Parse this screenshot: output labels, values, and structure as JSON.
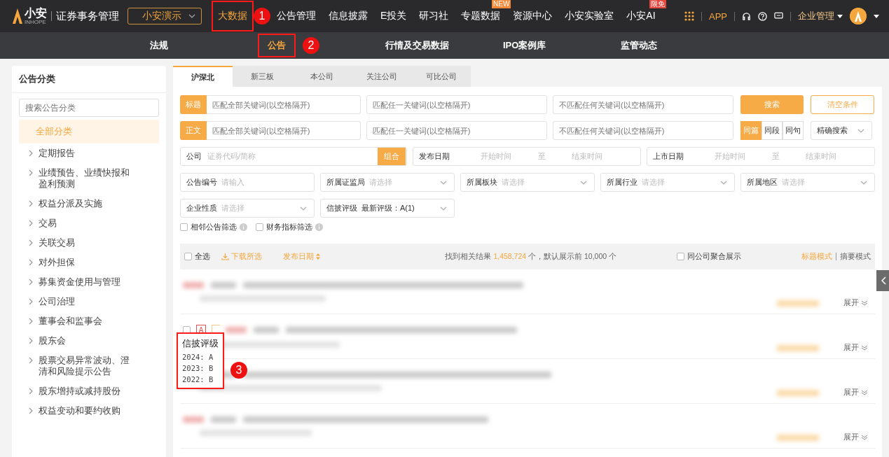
{
  "header": {
    "logo_text": "小安",
    "logo_sub": "INHOPE",
    "app_title": "证券事务管理",
    "org_select": "小安演示",
    "app_link": "APP",
    "company_menu": "企业管理",
    "nav": [
      {
        "label": "大数据",
        "selected": true,
        "callout": "1"
      },
      {
        "label": "公告管理",
        "selected": false
      },
      {
        "label": "信息披露",
        "selected": false
      },
      {
        "label": "E投关",
        "selected": false
      },
      {
        "label": "研习社",
        "selected": false
      },
      {
        "label": "专题数据",
        "selected": false,
        "badge": {
          "text": "NEW",
          "color": "#f5893a"
        }
      },
      {
        "label": "资源中心",
        "selected": false
      },
      {
        "label": "小安实验室",
        "selected": false
      },
      {
        "label": "小安AI",
        "selected": false,
        "badge": {
          "text": "限免",
          "color": "#e8453c"
        }
      }
    ]
  },
  "subnav": [
    {
      "label": "法规",
      "selected": false
    },
    {
      "label": "公告",
      "selected": true,
      "callout": "2"
    },
    {
      "label": "行情及交易数据",
      "selected": false
    },
    {
      "label": "IPO案例库",
      "selected": false
    },
    {
      "label": "监管动态",
      "selected": false
    }
  ],
  "sidebar": {
    "title": "公告分类",
    "search_placeholder": "搜索公告分类",
    "items": [
      {
        "label": "全部分类",
        "selected": true,
        "expandable": false
      },
      {
        "label": "定期报告",
        "selected": false,
        "expandable": true
      },
      {
        "label": "业绩预告、业绩快报和盈利预测",
        "selected": false,
        "expandable": true
      },
      {
        "label": "权益分派及实施",
        "selected": false,
        "expandable": true
      },
      {
        "label": "交易",
        "selected": false,
        "expandable": true
      },
      {
        "label": "关联交易",
        "selected": false,
        "expandable": true
      },
      {
        "label": "对外担保",
        "selected": false,
        "expandable": true
      },
      {
        "label": "募集资金使用与管理",
        "selected": false,
        "expandable": true
      },
      {
        "label": "公司治理",
        "selected": false,
        "expandable": true
      },
      {
        "label": "董事会和监事会",
        "selected": false,
        "expandable": true
      },
      {
        "label": "股东会",
        "selected": false,
        "expandable": true
      },
      {
        "label": "股票交易异常波动、澄清和风险提示公告",
        "selected": false,
        "expandable": true
      },
      {
        "label": "股东增持或减持股份",
        "selected": false,
        "expandable": true
      },
      {
        "label": "权益变动和要约收购",
        "selected": false,
        "expandable": true
      }
    ]
  },
  "tabs": [
    {
      "label": "沪深北",
      "selected": true
    },
    {
      "label": "新三板",
      "selected": false
    },
    {
      "label": "本公司",
      "selected": false
    },
    {
      "label": "关注公司",
      "selected": false
    },
    {
      "label": "可比公司",
      "selected": false
    }
  ],
  "filters": {
    "keyword_rows": [
      {
        "label": "标题",
        "placeholders": [
          "匹配全部关键词(以空格隔开)",
          "匹配任一关键词(以空格隔开)",
          "不匹配任何关键词(以空格隔开)"
        ]
      },
      {
        "label": "正文",
        "placeholders": [
          "匹配全部关键词(以空格隔开)",
          "匹配任一关键词(以空格隔开)",
          "不匹配任何关键词(以空格隔开)"
        ]
      }
    ],
    "search_button": "搜索",
    "clear_button": "清空条件",
    "scope": [
      {
        "label": "同篇",
        "selected": true
      },
      {
        "label": "同段",
        "selected": false
      },
      {
        "label": "同句",
        "selected": false
      }
    ],
    "match_mode": "精确搜索",
    "company": {
      "label": "公司",
      "placeholder": "证券代码/简称",
      "button": "组合"
    },
    "date_ranges": [
      {
        "label": "发布日期",
        "start": "开始时间",
        "sep": "至",
        "end": "结束时间"
      },
      {
        "label": "上市日期",
        "start": "开始时间",
        "sep": "至",
        "end": "结束时间"
      }
    ],
    "selects": [
      {
        "kind": "input",
        "label": "公告编号",
        "placeholder": "请输入"
      },
      {
        "kind": "select",
        "label": "所属证监局",
        "placeholder": "请选择"
      },
      {
        "kind": "select",
        "label": "所属板块",
        "placeholder": "请选择"
      },
      {
        "kind": "select",
        "label": "所属行业",
        "placeholder": "请选择"
      },
      {
        "kind": "select",
        "label": "所属地区",
        "placeholder": "请选择"
      },
      {
        "kind": "select",
        "label": "企业性质",
        "placeholder": "请选择"
      },
      {
        "kind": "select",
        "label": "信披评级",
        "value": "最新评级：A(1)"
      }
    ],
    "checks": [
      {
        "label": "相邻公告筛选",
        "checked": false
      },
      {
        "label": "财务指标筛选",
        "checked": false
      }
    ]
  },
  "results": {
    "select_all": {
      "label": "全选",
      "checked": false
    },
    "download": "下载所选",
    "sort": "发布日期",
    "summary": "找到相关结果 **1,458,724** 个，默认展示前 10,000 个",
    "group": {
      "label": "同公司聚合展示",
      "checked": false
    },
    "modes": [
      {
        "label": "标题模式",
        "selected": true
      },
      {
        "label": "摘要模式",
        "selected": false
      }
    ],
    "rows": [
      {
        "expand": "展开"
      },
      {
        "expand": "展开",
        "checked": false,
        "rating": "A",
        "tooltip": {
          "title": "信披评级",
          "lines": [
            "2024: A",
            "2023: B",
            "2022: B"
          ],
          "callout": "3"
        }
      },
      {
        "expand": "展开"
      },
      {
        "expand": "展开"
      }
    ]
  }
}
